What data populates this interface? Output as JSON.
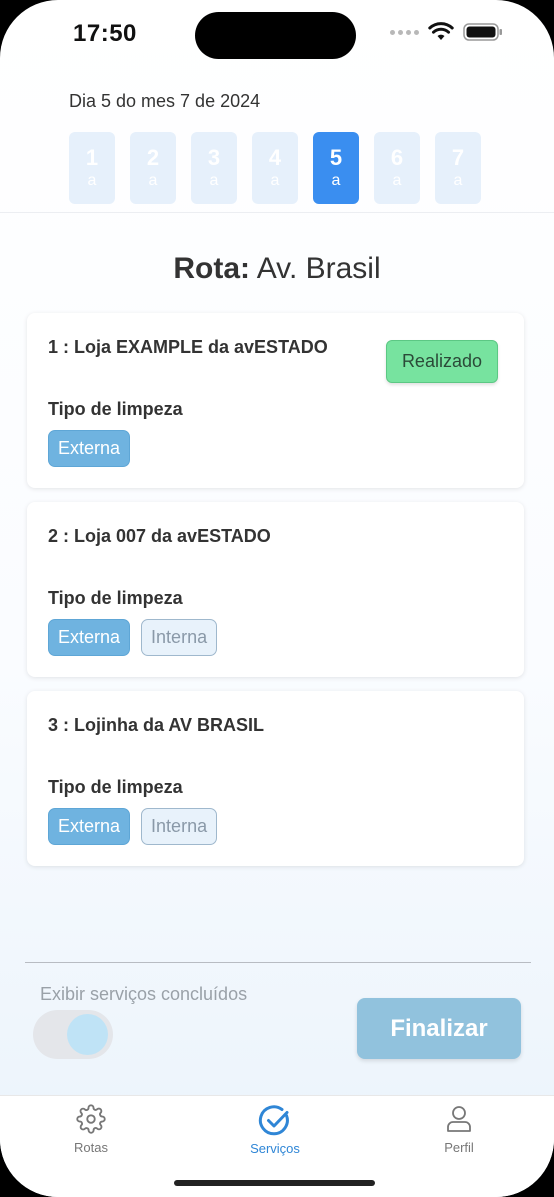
{
  "status_bar": {
    "time": "17:50"
  },
  "date_header": {
    "label": "Dia 5 do mes 7 de 2024",
    "days": [
      {
        "num": "1",
        "sub": "a",
        "active": false
      },
      {
        "num": "2",
        "sub": "a",
        "active": false
      },
      {
        "num": "3",
        "sub": "a",
        "active": false
      },
      {
        "num": "4",
        "sub": "a",
        "active": false
      },
      {
        "num": "5",
        "sub": "a",
        "active": true
      },
      {
        "num": "6",
        "sub": "a",
        "active": false
      },
      {
        "num": "7",
        "sub": "a",
        "active": false
      }
    ]
  },
  "route": {
    "prefix": "Rota:",
    "name": "Av. Brasil"
  },
  "services": [
    {
      "title": "1 : Loja EXAMPLE da avESTADO",
      "cleaning_label": "Tipo de limpeza",
      "chips": [
        {
          "label": "Externa",
          "selected": true
        }
      ],
      "badge": "Realizado"
    },
    {
      "title": "2 : Loja 007 da avESTADO",
      "cleaning_label": "Tipo de limpeza",
      "chips": [
        {
          "label": "Externa",
          "selected": true
        },
        {
          "label": "Interna",
          "selected": false
        }
      ]
    },
    {
      "title": "3 : Lojinha da AV BRASIL",
      "cleaning_label": "Tipo de limpeza",
      "chips": [
        {
          "label": "Externa",
          "selected": true
        },
        {
          "label": "Interna",
          "selected": false
        }
      ]
    }
  ],
  "footer": {
    "toggle_label": "Exibir serviços concluídos",
    "toggle_on": true,
    "finish_label": "Finalizar"
  },
  "tabs": [
    {
      "label": "Rotas",
      "icon": "gear-icon",
      "active": false
    },
    {
      "label": "Serviços",
      "icon": "check-circle-icon",
      "active": true
    },
    {
      "label": "Perfil",
      "icon": "user-icon",
      "active": false
    }
  ],
  "colors": {
    "accent": "#3a8ef0",
    "chip_selected": "#6fb3e0",
    "badge_done": "#77e39f",
    "tab_active": "#2f86d6",
    "tab_inactive": "#777777"
  }
}
